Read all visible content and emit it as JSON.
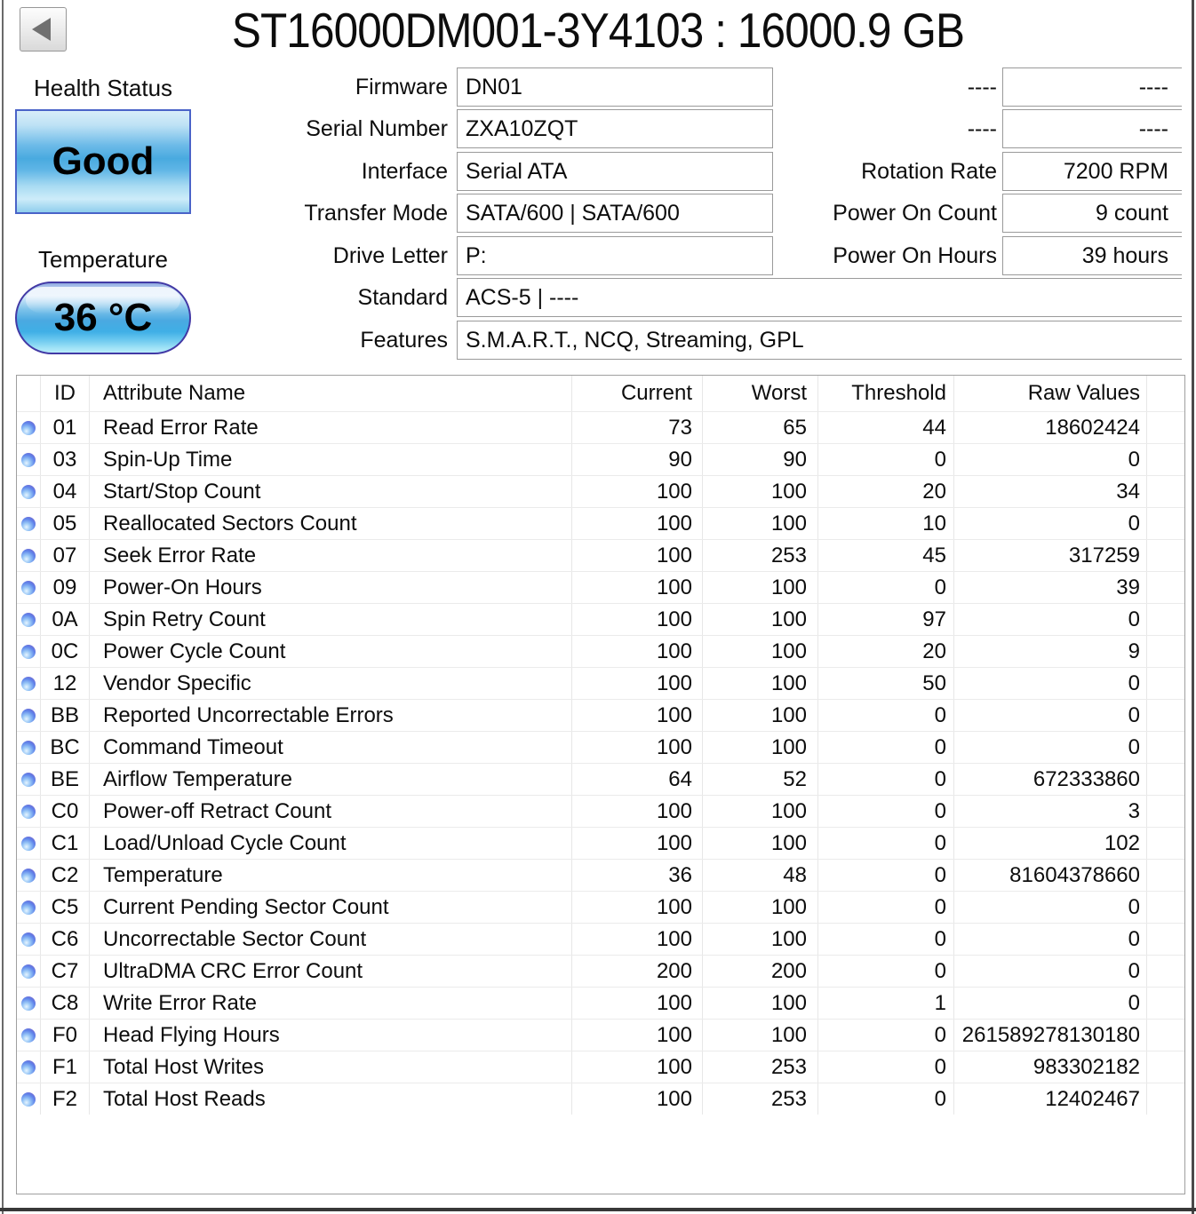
{
  "window": {
    "title": "ST16000DM001-3Y4103 : 16000.9 GB"
  },
  "health": {
    "label": "Health Status",
    "status": "Good",
    "temperature_label": "Temperature",
    "temperature_value": "36 °C"
  },
  "info_fields": [
    {
      "label": "Firmware",
      "value": "DN01",
      "wide": false
    },
    {
      "label": "Serial Number",
      "value": "ZXA10ZQT",
      "wide": false
    },
    {
      "label": "Interface",
      "value": "Serial ATA",
      "wide": false
    },
    {
      "label": "Transfer Mode",
      "value": "SATA/600 | SATA/600",
      "wide": false
    },
    {
      "label": "Drive Letter",
      "value": "P:",
      "wide": false
    },
    {
      "label": "Standard",
      "value": "ACS-5 | ----",
      "wide": true
    },
    {
      "label": "Features",
      "value": "S.M.A.R.T., NCQ, Streaming, GPL",
      "wide": true
    }
  ],
  "stat_fields": [
    {
      "label": "----",
      "value": "----"
    },
    {
      "label": "----",
      "value": "----"
    },
    {
      "label": "Rotation Rate",
      "value": "7200 RPM"
    },
    {
      "label": "Power On Count",
      "value": "9 count"
    },
    {
      "label": "Power On Hours",
      "value": "39 hours"
    }
  ],
  "smart_table": {
    "headers": {
      "id": "ID",
      "name": "Attribute Name",
      "current": "Current",
      "worst": "Worst",
      "threshold": "Threshold",
      "raw": "Raw Values"
    },
    "rows": [
      {
        "id": "01",
        "name": "Read Error Rate",
        "current": "73",
        "worst": "65",
        "threshold": "44",
        "raw": "18602424"
      },
      {
        "id": "03",
        "name": "Spin-Up Time",
        "current": "90",
        "worst": "90",
        "threshold": "0",
        "raw": "0"
      },
      {
        "id": "04",
        "name": "Start/Stop Count",
        "current": "100",
        "worst": "100",
        "threshold": "20",
        "raw": "34"
      },
      {
        "id": "05",
        "name": "Reallocated Sectors Count",
        "current": "100",
        "worst": "100",
        "threshold": "10",
        "raw": "0"
      },
      {
        "id": "07",
        "name": "Seek Error Rate",
        "current": "100",
        "worst": "253",
        "threshold": "45",
        "raw": "317259"
      },
      {
        "id": "09",
        "name": "Power-On Hours",
        "current": "100",
        "worst": "100",
        "threshold": "0",
        "raw": "39"
      },
      {
        "id": "0A",
        "name": "Spin Retry Count",
        "current": "100",
        "worst": "100",
        "threshold": "97",
        "raw": "0"
      },
      {
        "id": "0C",
        "name": "Power Cycle Count",
        "current": "100",
        "worst": "100",
        "threshold": "20",
        "raw": "9"
      },
      {
        "id": "12",
        "name": "Vendor Specific",
        "current": "100",
        "worst": "100",
        "threshold": "50",
        "raw": "0"
      },
      {
        "id": "BB",
        "name": "Reported Uncorrectable Errors",
        "current": "100",
        "worst": "100",
        "threshold": "0",
        "raw": "0"
      },
      {
        "id": "BC",
        "name": "Command Timeout",
        "current": "100",
        "worst": "100",
        "threshold": "0",
        "raw": "0"
      },
      {
        "id": "BE",
        "name": "Airflow Temperature",
        "current": "64",
        "worst": "52",
        "threshold": "0",
        "raw": "672333860"
      },
      {
        "id": "C0",
        "name": "Power-off Retract Count",
        "current": "100",
        "worst": "100",
        "threshold": "0",
        "raw": "3"
      },
      {
        "id": "C1",
        "name": "Load/Unload Cycle Count",
        "current": "100",
        "worst": "100",
        "threshold": "0",
        "raw": "102"
      },
      {
        "id": "C2",
        "name": "Temperature",
        "current": "36",
        "worst": "48",
        "threshold": "0",
        "raw": "81604378660"
      },
      {
        "id": "C5",
        "name": "Current Pending Sector Count",
        "current": "100",
        "worst": "100",
        "threshold": "0",
        "raw": "0"
      },
      {
        "id": "C6",
        "name": "Uncorrectable Sector Count",
        "current": "100",
        "worst": "100",
        "threshold": "0",
        "raw": "0"
      },
      {
        "id": "C7",
        "name": "UltraDMA CRC Error Count",
        "current": "200",
        "worst": "200",
        "threshold": "0",
        "raw": "0"
      },
      {
        "id": "C8",
        "name": "Write Error Rate",
        "current": "100",
        "worst": "100",
        "threshold": "1",
        "raw": "0"
      },
      {
        "id": "F0",
        "name": "Head Flying Hours",
        "current": "100",
        "worst": "100",
        "threshold": "0",
        "raw": "261589278130180"
      },
      {
        "id": "F1",
        "name": "Total Host Writes",
        "current": "100",
        "worst": "253",
        "threshold": "0",
        "raw": "983302182"
      },
      {
        "id": "F2",
        "name": "Total Host Reads",
        "current": "100",
        "worst": "253",
        "threshold": "0",
        "raw": "12402467"
      }
    ]
  }
}
